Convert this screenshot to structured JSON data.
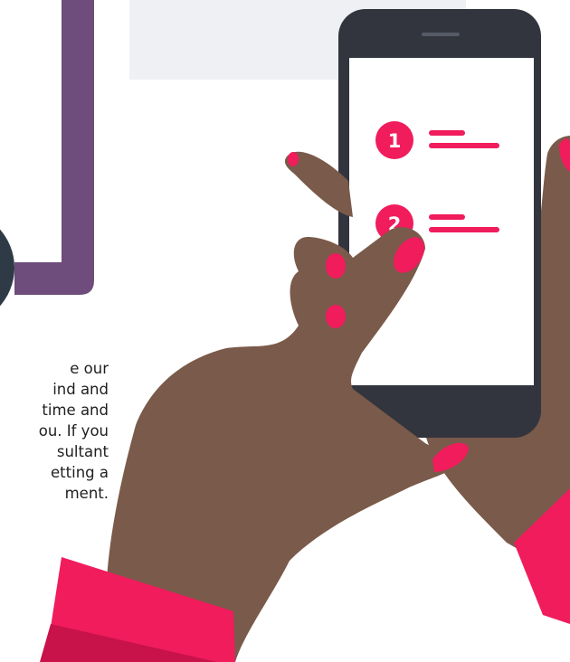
{
  "illustration": {
    "steps": [
      {
        "number": "1"
      },
      {
        "number": "2"
      }
    ],
    "colors": {
      "accent": "#f01c5c",
      "purple": "#6e4c7c",
      "skin": "#7a5a4a",
      "phone": "#32353e",
      "panel": "#eef0f4"
    }
  },
  "text_lines": [
    "e our",
    "ind and",
    "time and",
    "ou. If you",
    "sultant",
    "etting a",
    "ment."
  ]
}
